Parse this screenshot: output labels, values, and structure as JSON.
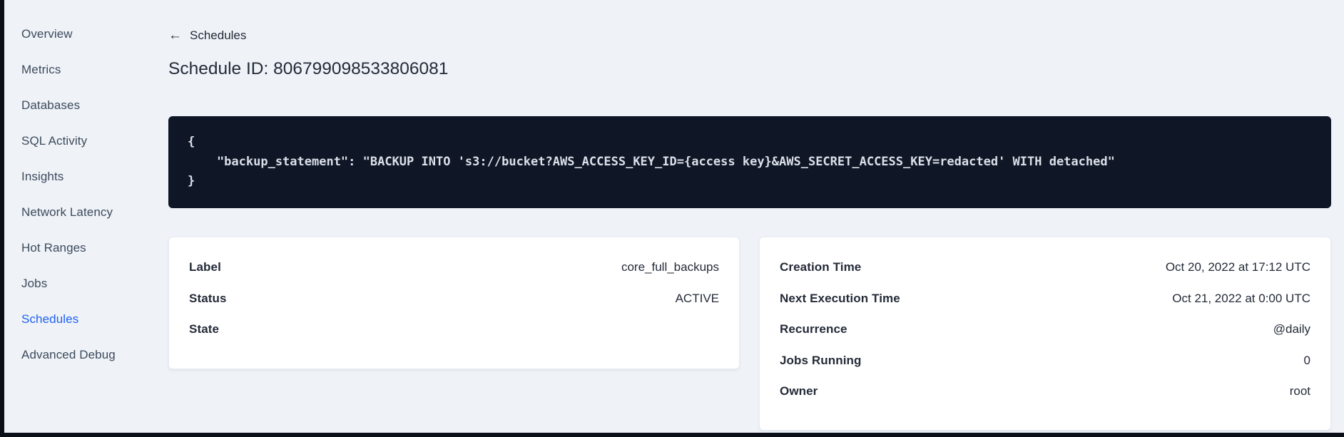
{
  "colors": {
    "page_bg": "#eff3f8",
    "frame": "#0b0f17",
    "code_bg": "#0f1626",
    "code_text": "#dbe0e9",
    "text_primary": "#242b38",
    "sidebar_text": "#3d4a5c",
    "active_blue": "#2161f0",
    "card_bg": "#ffffff",
    "card_border": "#e7ebf1"
  },
  "sidebar": {
    "items": [
      {
        "label": "Overview",
        "active": false
      },
      {
        "label": "Metrics",
        "active": false
      },
      {
        "label": "Databases",
        "active": false
      },
      {
        "label": "SQL Activity",
        "active": false
      },
      {
        "label": "Insights",
        "active": false
      },
      {
        "label": "Network Latency",
        "active": false
      },
      {
        "label": "Hot Ranges",
        "active": false
      },
      {
        "label": "Jobs",
        "active": false
      },
      {
        "label": "Schedules",
        "active": true
      },
      {
        "label": "Advanced Debug",
        "active": false
      }
    ]
  },
  "header": {
    "back_arrow": "←",
    "back_label": "Schedules",
    "title": "Schedule ID: 806799098533806081"
  },
  "code_block": {
    "lines": [
      "{",
      "    \"backup_statement\": \"BACKUP INTO 's3://bucket?AWS_ACCESS_KEY_ID={access key}&AWS_SECRET_ACCESS_KEY=redacted' WITH detached\"",
      "}"
    ]
  },
  "cards": {
    "schedule_details": {
      "rows": [
        {
          "label": "Label",
          "value": "core_full_backups"
        },
        {
          "label": "Status",
          "value": "ACTIVE"
        },
        {
          "label": "State",
          "value": ""
        }
      ]
    },
    "execution_details": {
      "rows": [
        {
          "label": "Creation Time",
          "value": "Oct 20, 2022 at 17:12 UTC"
        },
        {
          "label": "Next Execution Time",
          "value": "Oct 21, 2022 at 0:00 UTC"
        },
        {
          "label": "Recurrence",
          "value": "@daily"
        },
        {
          "label": "Jobs Running",
          "value": "0"
        },
        {
          "label": "Owner",
          "value": "root"
        }
      ]
    }
  }
}
